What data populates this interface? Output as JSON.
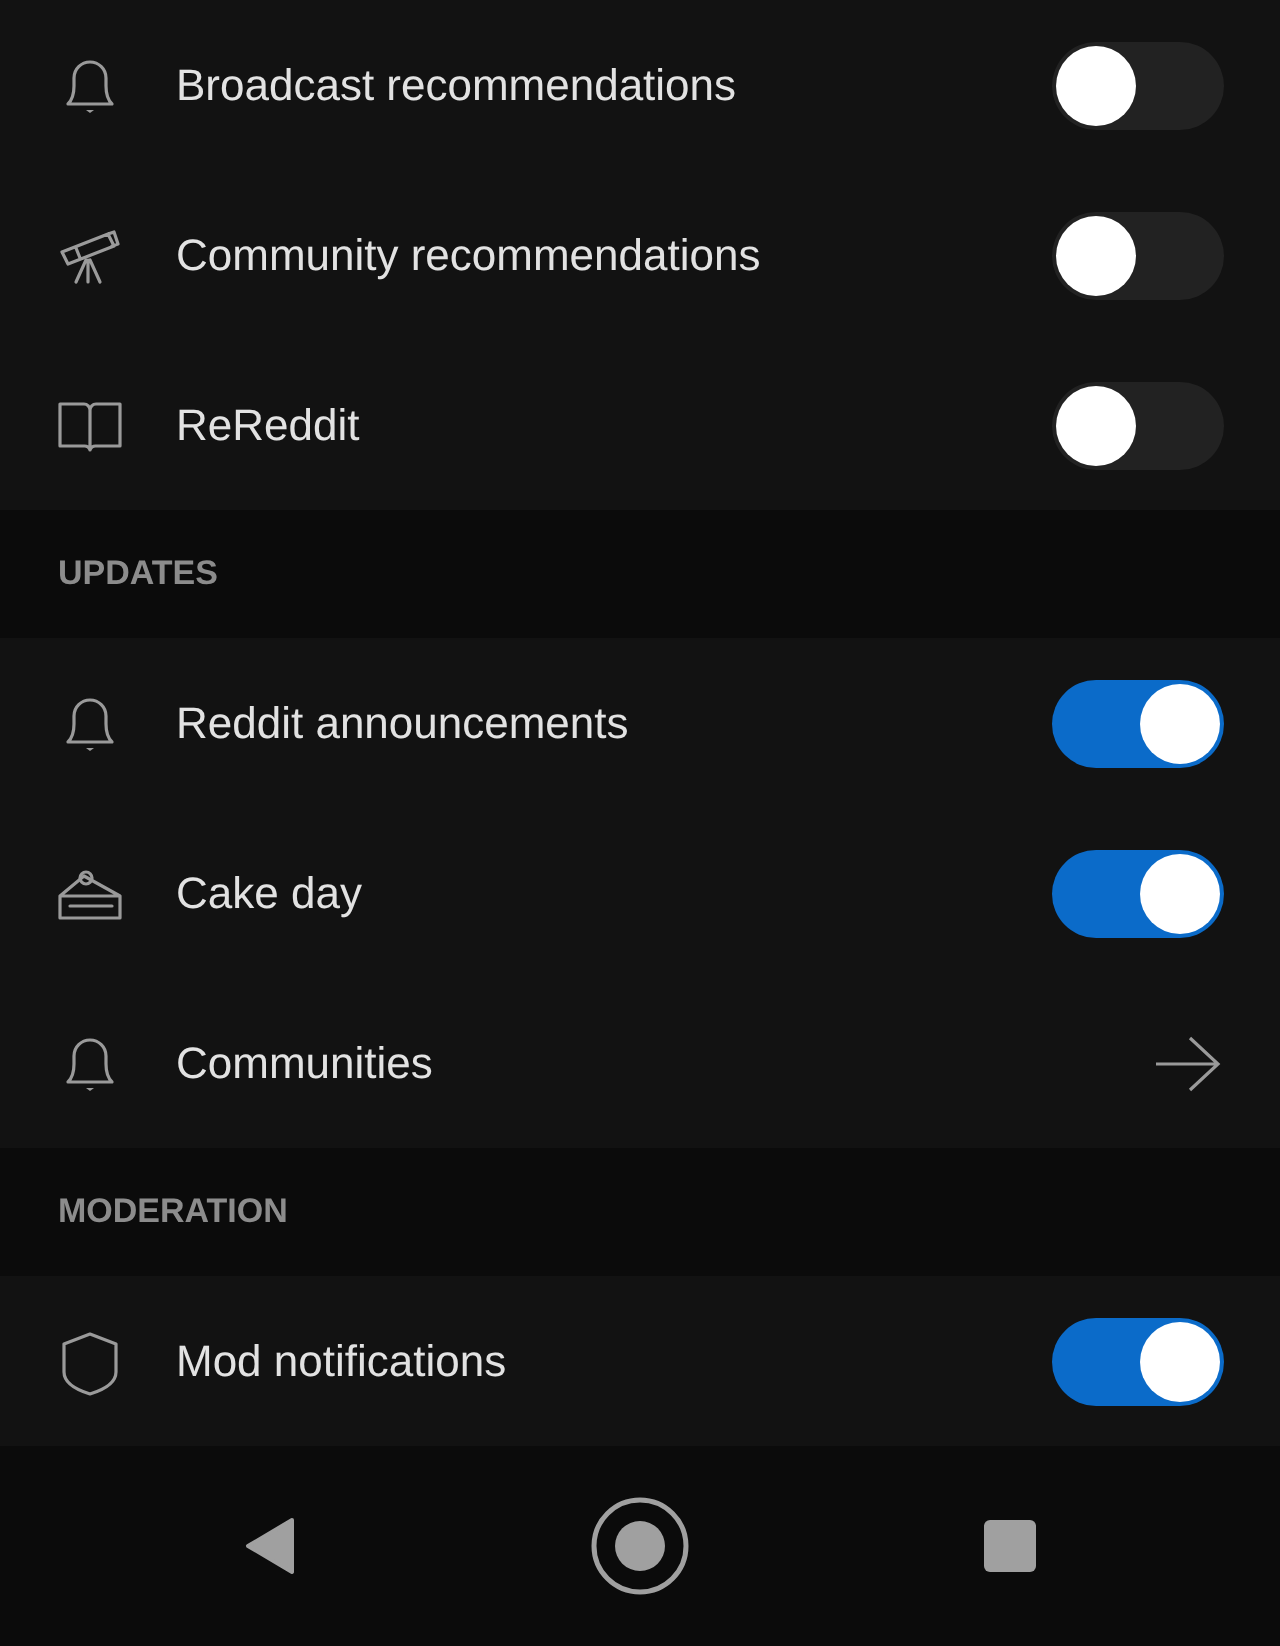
{
  "sections": [
    {
      "rows": [
        {
          "label": "Broadcast recommendations",
          "kind": "toggle",
          "on": false
        },
        {
          "label": "Community recommendations",
          "kind": "toggle",
          "on": false
        },
        {
          "label": "ReReddit",
          "kind": "toggle",
          "on": false
        }
      ]
    },
    {
      "header": "UPDATES",
      "rows": [
        {
          "label": "Reddit announcements",
          "kind": "toggle",
          "on": true
        },
        {
          "label": "Cake day",
          "kind": "toggle",
          "on": true
        },
        {
          "label": "Communities",
          "kind": "link"
        }
      ]
    },
    {
      "header": "MODERATION",
      "rows": [
        {
          "label": "Mod notifications",
          "kind": "toggle",
          "on": true
        }
      ]
    }
  ]
}
